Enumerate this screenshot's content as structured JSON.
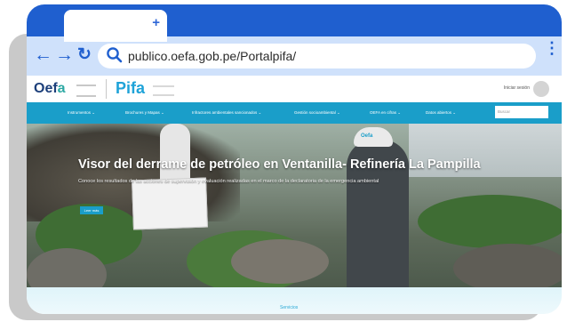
{
  "browser": {
    "new_tab_symbol": "+",
    "back_symbol": "←",
    "forward_symbol": "→",
    "reload_symbol": "↻",
    "url": "publico.oefa.gob.pe/Portalpifa/",
    "menu_symbol": "⋮"
  },
  "site": {
    "brand_left_main": "Oef",
    "brand_left_accent": "a",
    "brand_right": "Pifa",
    "login_text": "Iniciar sesión",
    "menu": [
      "Instrumentos  ⌄",
      "Brochures y Mapas  ⌄",
      "Infractores ambientales sancionados  ⌄",
      "Gestión socioambiental  ⌄",
      "OEFA en cifras  ⌄",
      "Datos abiertos  ⌄"
    ],
    "search_placeholder": "Buscar"
  },
  "hero": {
    "title": "Visor del derrame de petróleo en Ventanilla- Refinería La Pampilla",
    "subtitle": "Conoce los resultados de las acciones de supervisión y evaluación realizadas en el marco de la declaratoria de la emergencia ambiental",
    "button_label": "Leer más",
    "helmet_text": "Oefa"
  },
  "services": {
    "title": "Servicios"
  }
}
